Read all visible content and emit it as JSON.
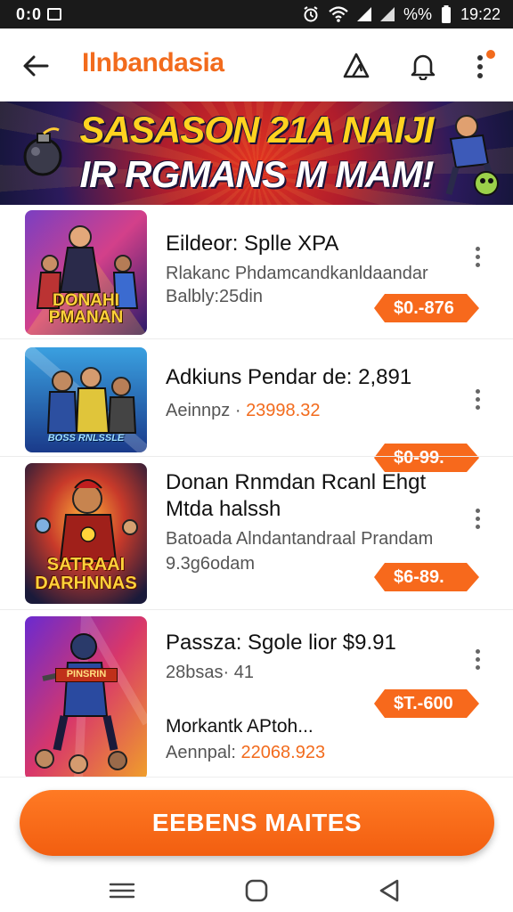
{
  "status_bar": {
    "left_text": "0:0",
    "battery_text": "%%",
    "time": "19:22"
  },
  "app_bar": {
    "title": "Ilnbandasia",
    "icons": [
      "back-arrow-icon",
      "alert-icon",
      "bell-icon",
      "more-vert-icon"
    ]
  },
  "banner": {
    "line1": "SASASON 21A NAIJI",
    "line2": "IR RGMANS M MAM!"
  },
  "items": [
    {
      "title": "Eildeor: Splle XPA",
      "sub1": "Rlakanc Phdamcandkanldaandar",
      "sub2": "Balbly:25din",
      "price": "$0.-876",
      "thumb_text_1": "DONAHI",
      "thumb_text_2": "PMANAN"
    },
    {
      "title": "Adkiuns Pendar de: 2,891",
      "sub_prefix": "Aeinnpz ·",
      "sub_accent": "23998.32",
      "price": "$0-99.",
      "thumb_text_1": "BOSS RNLSSLE"
    },
    {
      "title_line1": "Donan Rnmdan Rcanl Ehgt",
      "title_line2": "Mtda halssh",
      "sub1": "Batoada Alndantandraal Prandam",
      "sub2": "9.3g6odam",
      "price": "$6-89.",
      "thumb_text_1": "SATRAAI",
      "thumb_text_2": "DARHNNAS"
    },
    {
      "title": "Passza: Sgole lior $9.91",
      "sub1": "28bsas· 41",
      "price": "$T.-600",
      "extra_title": "Morkantk APtoh...",
      "extra_sub_prefix": "Aennpal:",
      "extra_sub_accent": "22068.923",
      "thumb_text_1": "PINSRIN"
    }
  ],
  "cta": {
    "label": "EEBENS MAITES"
  },
  "colors": {
    "accent": "#f26b1d",
    "status_bar": "#1a1a1a",
    "banner_yellow": "#ffd320"
  }
}
